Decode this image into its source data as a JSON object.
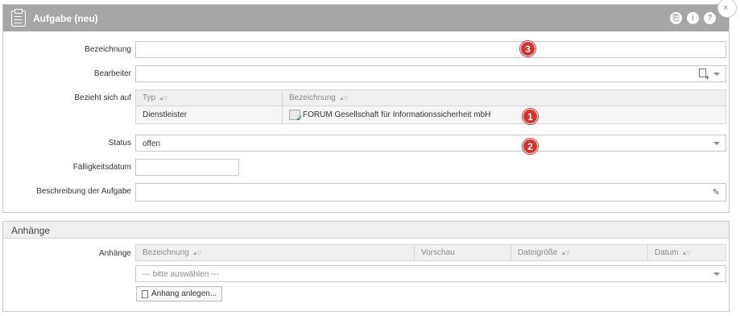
{
  "window": {
    "title": "Aufgabe (neu)",
    "actions": [
      {
        "icon": "clone-icon",
        "glyph": "⎘"
      },
      {
        "icon": "info-icon",
        "glyph": "i"
      },
      {
        "icon": "help-icon",
        "glyph": "?"
      }
    ],
    "close_glyph": "×"
  },
  "form": {
    "bezeichnung": {
      "label": "Bezeichnung",
      "value": ""
    },
    "bearbeiter": {
      "label": "Bearbeiter",
      "value": ""
    },
    "bezieht_sich_auf": {
      "label": "Bezieht sich auf",
      "columns": [
        "Typ",
        "Bezeichnung"
      ],
      "sort_glyph": "▲▽",
      "rows": [
        {
          "typ": "Dienstleister",
          "bezeichnung": "FORUM Gesellschaft für Informationssicherheit mbH"
        }
      ]
    },
    "status": {
      "label": "Status",
      "value": "offen"
    },
    "faelligkeitsdatum": {
      "label": "Fälligkeitsdatum",
      "value": ""
    },
    "beschreibung": {
      "label": "Beschreibung der Aufgabe",
      "value": "",
      "edit_glyph": "✎"
    }
  },
  "annotations": {
    "badge1": "1",
    "badge2": "2",
    "badge3": "3"
  },
  "anhaenge": {
    "section_title": "Anhänge",
    "label": "Anhänge",
    "columns": [
      "Bezeichnung",
      "Vorschau",
      "Dateigröße",
      "Datum"
    ],
    "select_placeholder": "--- bitte auswählen ---",
    "add_button": "Anhang anlegen..."
  },
  "colors": {
    "titlebar": "#a6a6a6",
    "badge": "#d9302c"
  }
}
